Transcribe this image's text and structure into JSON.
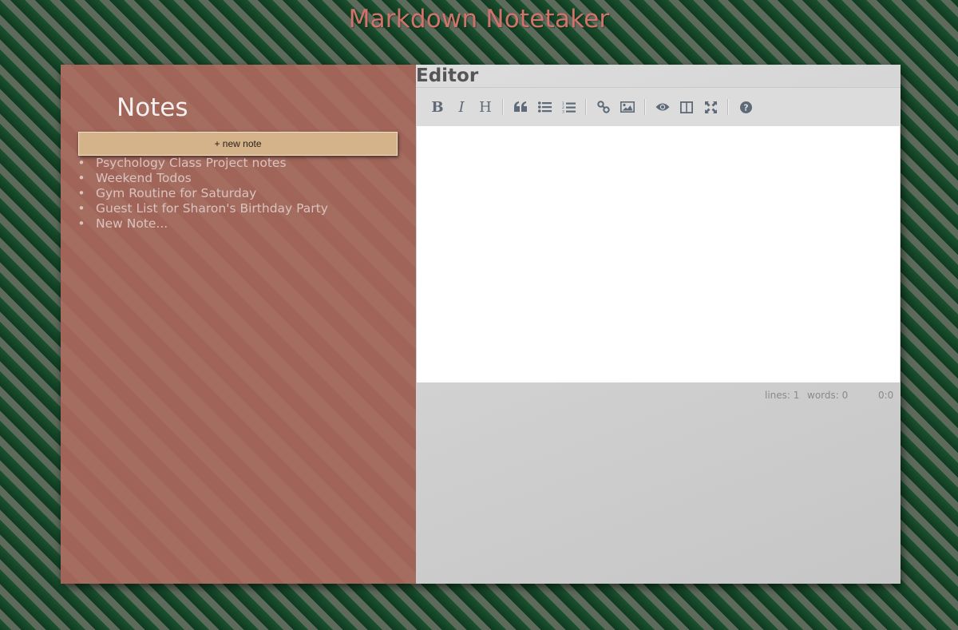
{
  "app": {
    "title": "Markdown Notetaker"
  },
  "sidebar": {
    "title": "Notes",
    "new_note_label": "+ new note",
    "notes": [
      {
        "title": "Psychology Class Project notes"
      },
      {
        "title": "Weekend Todos"
      },
      {
        "title": "Gym Routine for Saturday"
      },
      {
        "title": "Guest List for Sharon's Birthday Party"
      },
      {
        "title": "New Note..."
      }
    ],
    "bullet": "•"
  },
  "editor": {
    "title": "Editor",
    "content": "",
    "toolbar": [
      {
        "name": "bold",
        "label": "B",
        "icon": "bold-icon"
      },
      {
        "name": "italic",
        "label": "I",
        "icon": "italic-icon"
      },
      {
        "name": "heading",
        "label": "H",
        "icon": "heading-icon"
      },
      {
        "name": "quote",
        "icon": "quote-icon"
      },
      {
        "name": "unordered-list",
        "icon": "unordered-list-icon"
      },
      {
        "name": "ordered-list",
        "icon": "ordered-list-icon"
      },
      {
        "name": "link",
        "icon": "link-icon"
      },
      {
        "name": "image",
        "icon": "image-icon"
      },
      {
        "name": "preview",
        "icon": "eye-icon"
      },
      {
        "name": "side-by-side",
        "icon": "columns-icon"
      },
      {
        "name": "fullscreen",
        "icon": "fullscreen-icon"
      },
      {
        "name": "guide",
        "icon": "help-icon"
      }
    ],
    "status": {
      "lines": "lines: 1",
      "words": "words: 0",
      "cursor": "0:0"
    }
  },
  "colors": {
    "title": "#d2736b",
    "sidebar_bg": "#a06458",
    "button_bg": "#d4b28a",
    "toolbar_icon": "#5e6a77",
    "background_green": "#174a2b",
    "background_stripe": "#5d6a5c"
  }
}
